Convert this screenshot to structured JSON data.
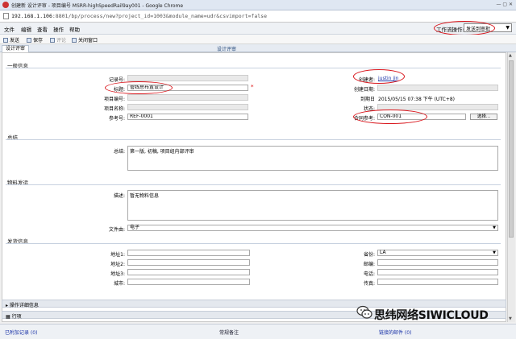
{
  "window": {
    "title": "创建新 设计评审 - 项目编号 MSRR-highSpeedRail9ay001 - Google Chrome",
    "url_prefix": "192.168.1.106",
    "url_rest": ":8801/bp/process/new?project_id=1003&module_name=udr&csvimport=false"
  },
  "menu": {
    "items": [
      "文件",
      "编辑",
      "查看",
      "操作",
      "帮助"
    ]
  },
  "workflow": {
    "label": "工作流操作:",
    "value": "发送到审批"
  },
  "toolbar": {
    "send": "发送",
    "save": "保存",
    "comment": "评论",
    "close": "关闭窗口"
  },
  "tab": {
    "label": "设计评审",
    "center_title": "设计评审"
  },
  "general": {
    "title": "一般信息",
    "record_no_label": "记录号:",
    "title_label": "标题:",
    "title_value": "管线总布置设计",
    "project_no_label": "项目编号:",
    "project_name_label": "项目名称:",
    "ref_label": "参考号:",
    "ref_value": "REF-0001",
    "creator_label": "创建者:",
    "creator_value": "justin jin",
    "created_date_label": "创建日期:",
    "due_label": "到期日",
    "due_value": "2015/05/15 07:38 下午 (UTC+8)",
    "status_label": "状态:",
    "contract_label": "合同参考:",
    "contract_value": "CON-001",
    "select_btn": "选择..."
  },
  "summary": {
    "title": "总结",
    "label": "总结:",
    "value": "第一版, 初稿, 项目组内部评审"
  },
  "material": {
    "title": "物料发运",
    "desc_label": "描述:",
    "desc_value": "暂无物料信息",
    "filetype_label": "文件由:",
    "filetype_value": "电子"
  },
  "shipping": {
    "title": "发货信息",
    "addr1": "地址1:",
    "addr2": "地址2:",
    "addr3": "地址3:",
    "city": "城市:",
    "province_label": "省份:",
    "province_value": "LA",
    "zip": "邮编:",
    "phone": "电话:",
    "fax": "传真:"
  },
  "details": {
    "title": "操作详细信息",
    "lines": "行项"
  },
  "bottom": {
    "attached": "已附加记录 (0)",
    "notes": "常规备注",
    "mail": "链接的邮件 (0)"
  },
  "watermark": {
    "text": "思纬网络SIWICLOUD"
  }
}
